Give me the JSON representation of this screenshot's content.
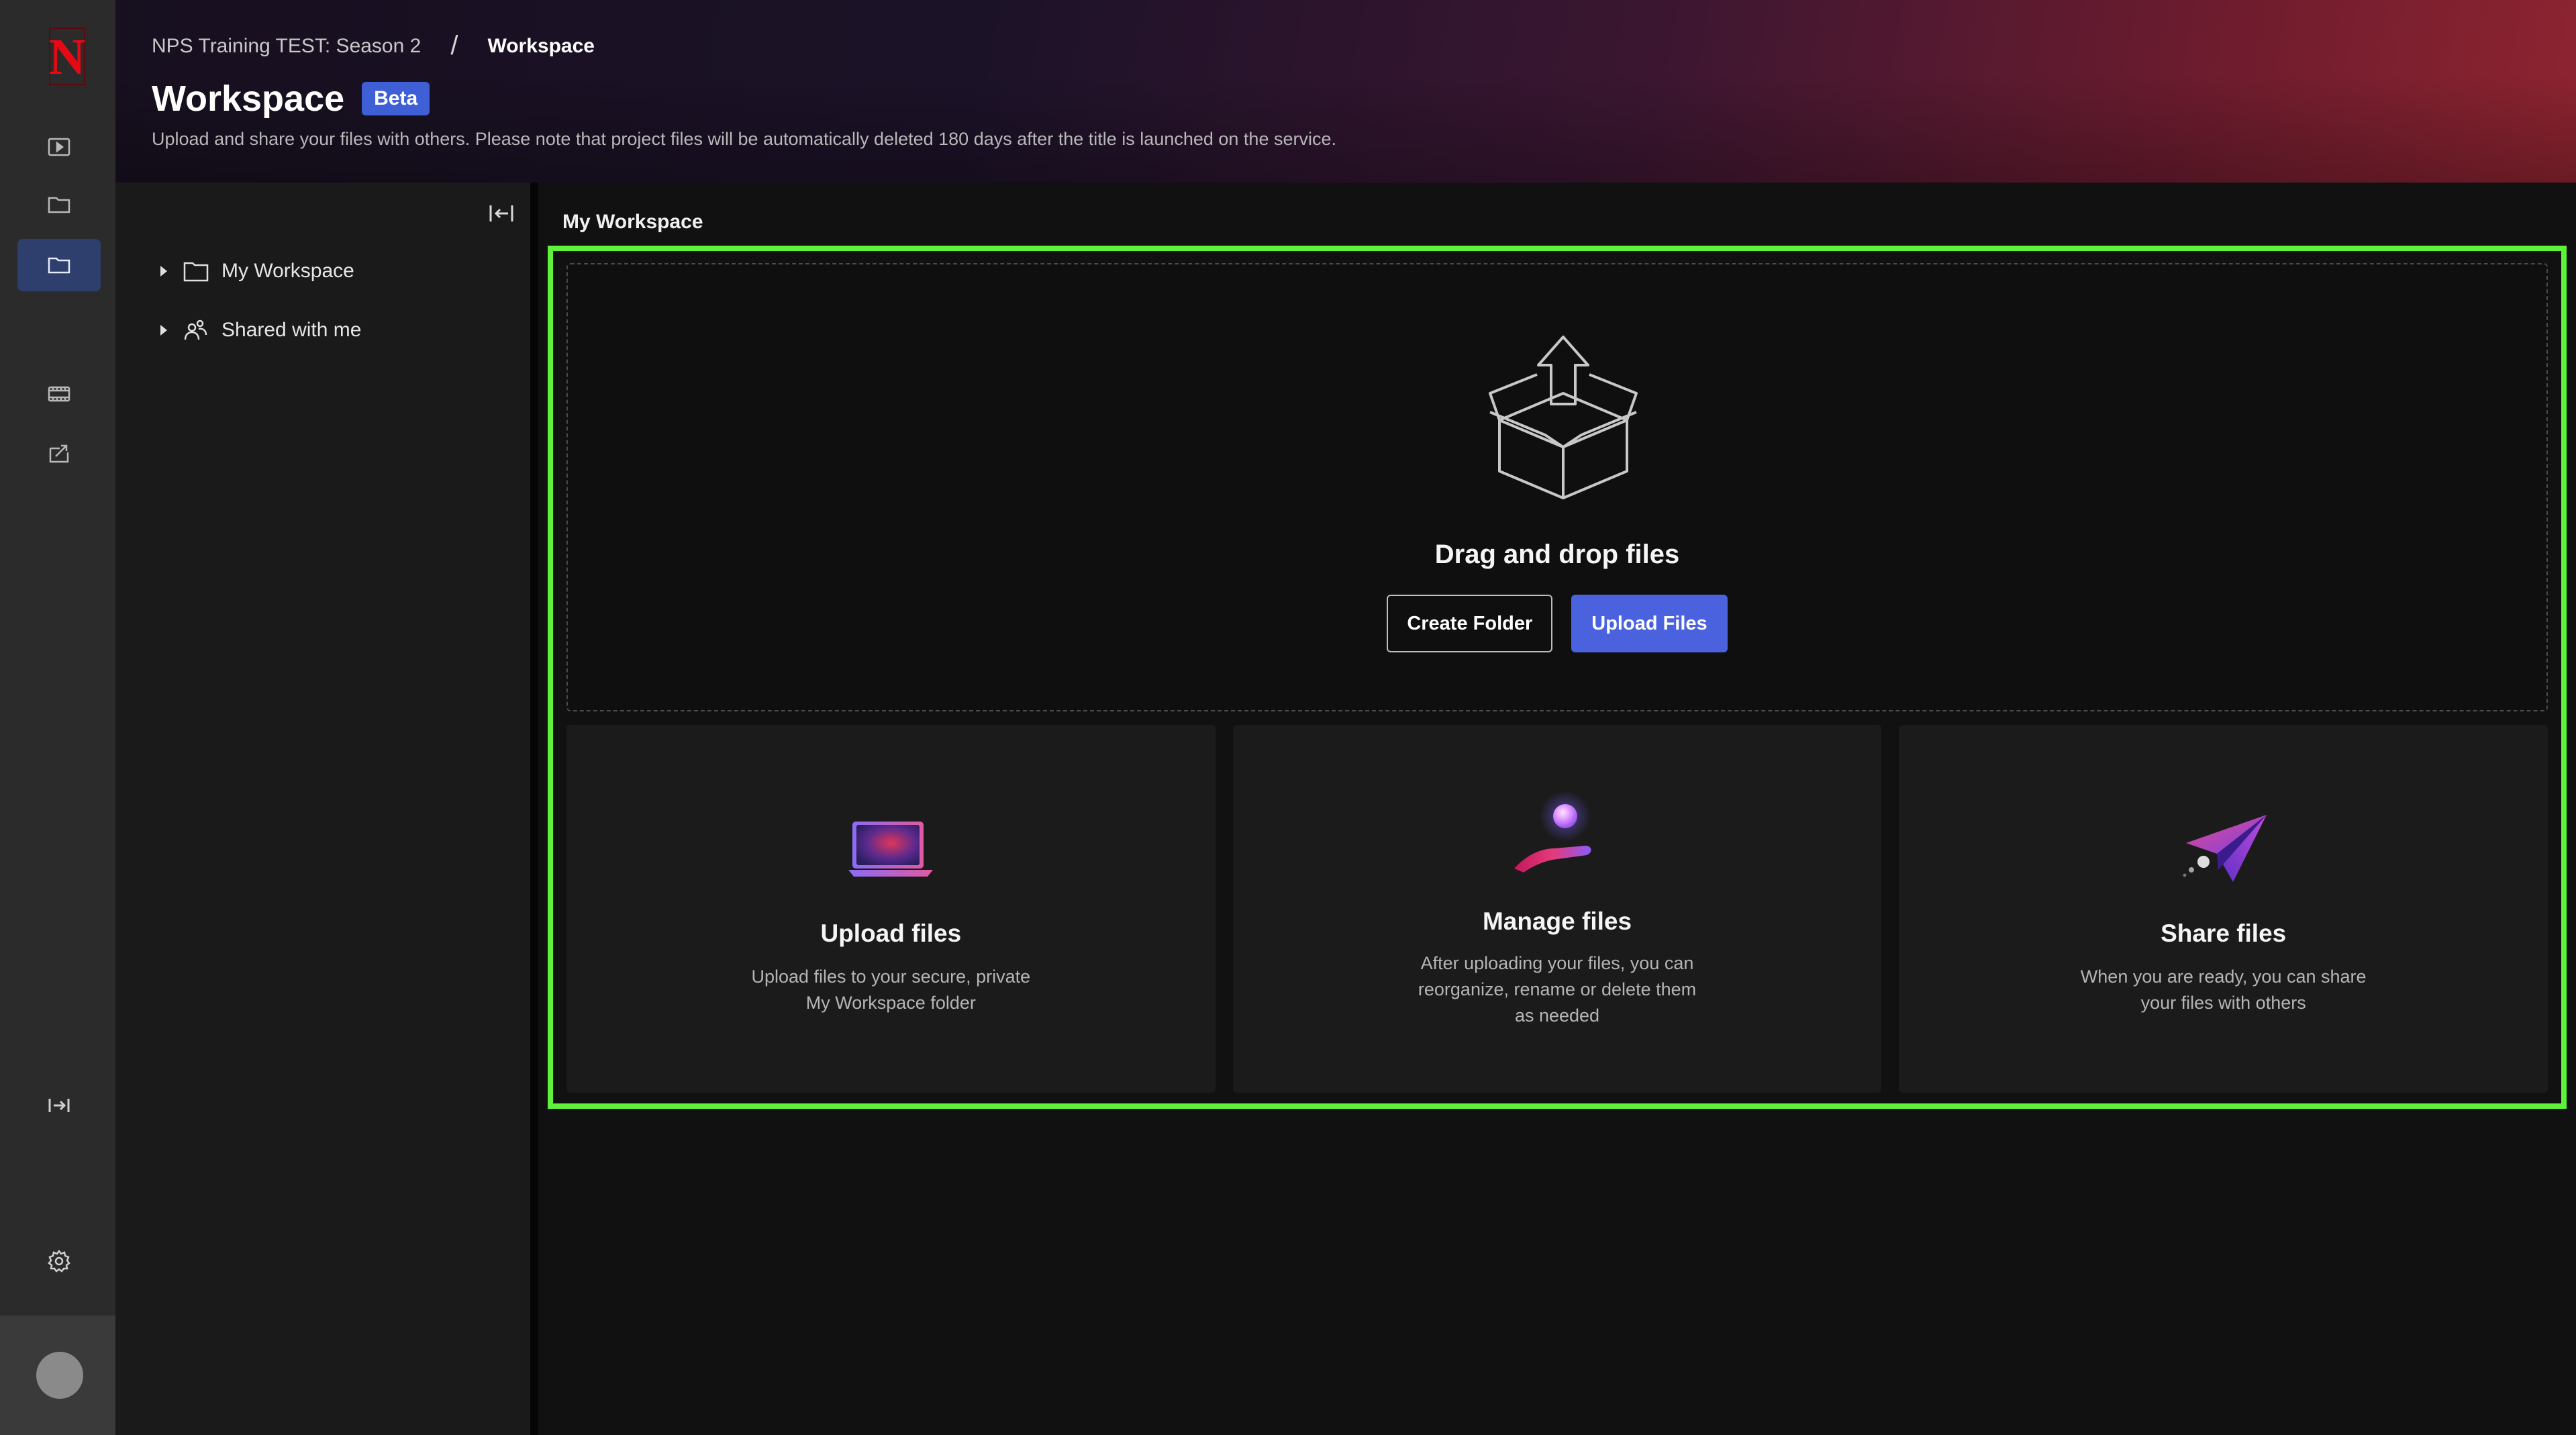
{
  "rail": {
    "logo_letter": "N",
    "items": [
      {
        "icon": "play-icon"
      },
      {
        "icon": "folder-icon"
      },
      {
        "icon": "folder-icon",
        "active": true
      },
      {
        "icon": "film-icon"
      },
      {
        "icon": "share-box-icon"
      },
      {
        "icon": "expand-icon"
      },
      {
        "icon": "gear-icon"
      }
    ]
  },
  "header": {
    "breadcrumb_parent": "NPS Training TEST: Season 2",
    "breadcrumb_separator": "/",
    "breadcrumb_current": "Workspace",
    "title": "Workspace",
    "badge": "Beta",
    "subtitle": "Upload and share your files with others. Please note that project files will be automatically deleted 180 days after the title is launched on the service."
  },
  "tree": {
    "items": [
      {
        "label": "My Workspace",
        "icon": "folder-icon"
      },
      {
        "label": "Shared with me",
        "icon": "shared-users-icon"
      }
    ]
  },
  "main": {
    "heading": "My Workspace",
    "dropzone": {
      "title": "Drag and drop files",
      "create_folder_label": "Create Folder",
      "upload_files_label": "Upload Files"
    },
    "cards": [
      {
        "title": "Upload files",
        "description": "Upload files to your secure, private\nMy Workspace folder",
        "icon": "laptop-icon"
      },
      {
        "title": "Manage files",
        "description": "After uploading your files, you can\nreorganize, rename or delete them\nas needed",
        "icon": "hand-orb-icon"
      },
      {
        "title": "Share files",
        "description": "When you are ready, you can share\nyour files with others",
        "icon": "paper-plane-icon"
      }
    ]
  },
  "colors": {
    "accent": "#4a62dd",
    "highlight": "#5ef23b",
    "brand_red": "#e50914"
  }
}
